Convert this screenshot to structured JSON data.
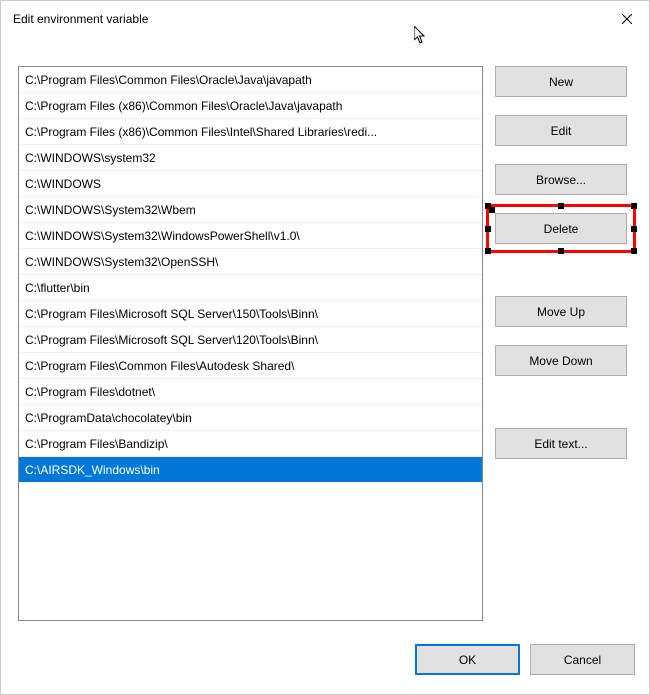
{
  "window": {
    "title": "Edit environment variable"
  },
  "list": {
    "items": [
      {
        "text": "C:\\Program Files\\Common Files\\Oracle\\Java\\javapath",
        "selected": false
      },
      {
        "text": "C:\\Program Files (x86)\\Common Files\\Oracle\\Java\\javapath",
        "selected": false
      },
      {
        "text": "C:\\Program Files (x86)\\Common Files\\Intel\\Shared Libraries\\redi...",
        "selected": false
      },
      {
        "text": "C:\\WINDOWS\\system32",
        "selected": false
      },
      {
        "text": "C:\\WINDOWS",
        "selected": false
      },
      {
        "text": "C:\\WINDOWS\\System32\\Wbem",
        "selected": false
      },
      {
        "text": "C:\\WINDOWS\\System32\\WindowsPowerShell\\v1.0\\",
        "selected": false
      },
      {
        "text": "C:\\WINDOWS\\System32\\OpenSSH\\",
        "selected": false
      },
      {
        "text": "C:\\flutter\\bin",
        "selected": false
      },
      {
        "text": "C:\\Program Files\\Microsoft SQL Server\\150\\Tools\\Binn\\",
        "selected": false
      },
      {
        "text": "C:\\Program Files\\Microsoft SQL Server\\120\\Tools\\Binn\\",
        "selected": false
      },
      {
        "text": "C:\\Program Files\\Common Files\\Autodesk Shared\\",
        "selected": false
      },
      {
        "text": "C:\\Program Files\\dotnet\\",
        "selected": false
      },
      {
        "text": "C:\\ProgramData\\chocolatey\\bin",
        "selected": false
      },
      {
        "text": "C:\\Program Files\\Bandizip\\",
        "selected": false
      },
      {
        "text": "C:\\AIRSDK_Windows\\bin",
        "selected": true
      }
    ]
  },
  "buttons": {
    "new": "New",
    "edit": "Edit",
    "browse": "Browse...",
    "delete": "Delete",
    "moveUp": "Move Up",
    "moveDown": "Move Down",
    "editText": "Edit text...",
    "ok": "OK",
    "cancel": "Cancel"
  }
}
